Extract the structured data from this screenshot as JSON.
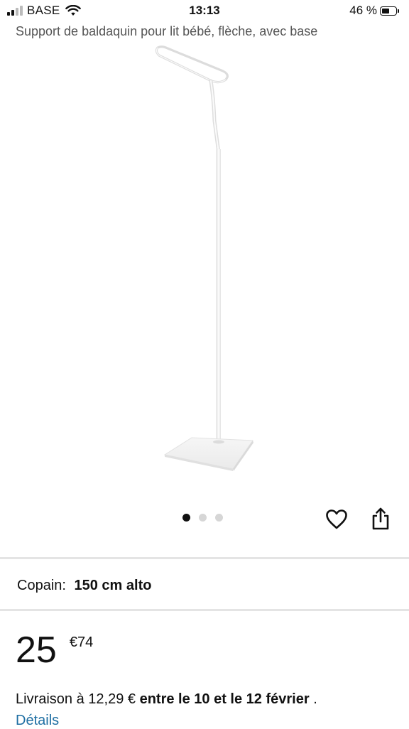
{
  "status_bar": {
    "carrier": "BASE",
    "time": "13:13",
    "battery_text": "46 %",
    "battery_level": 0.46,
    "signal_bars_filled": 2,
    "signal_bars_total": 4
  },
  "product": {
    "title": "Support de baldaquin pour lit bébé, flèche, avec base",
    "image_icon": "canopy-stand-photo",
    "carousel": {
      "count": 3,
      "active_index": 0
    }
  },
  "actions": {
    "wishlist_icon": "heart-icon",
    "share_icon": "share-icon"
  },
  "variant": {
    "label": "Copain:",
    "value": "150 cm alto"
  },
  "price": {
    "whole": "25",
    "fraction": "€74"
  },
  "delivery": {
    "prefix": "Livraison à 12,29 €",
    "dates": "entre le 10 et le 12 février",
    "suffix": ".",
    "details_link": "Détails"
  },
  "colors": {
    "link": "#1f6fa3",
    "divider": "#e4e4e4",
    "dot_active": "#111111",
    "dot_inactive": "#d6d6d6"
  }
}
